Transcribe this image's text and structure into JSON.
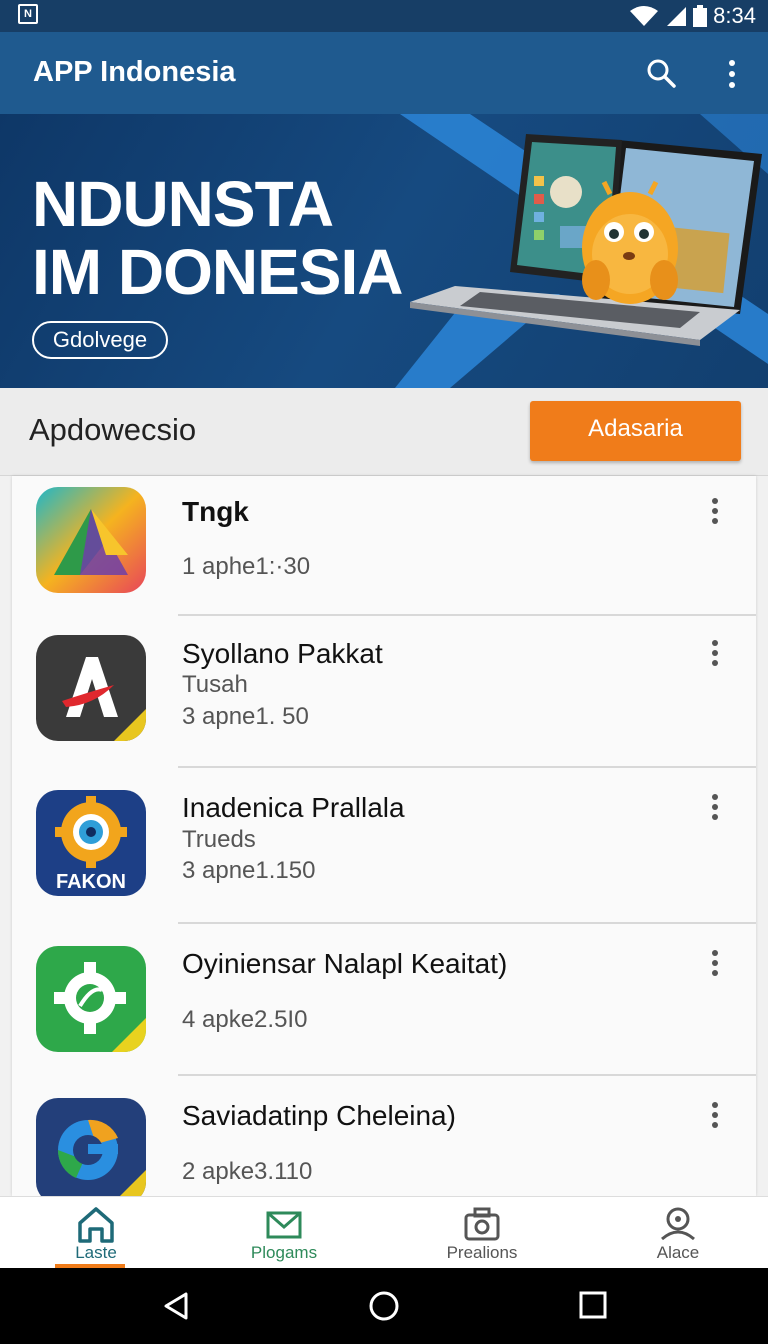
{
  "status_bar": {
    "left_badge": "N",
    "time": "8:34"
  },
  "app_bar": {
    "title": "APP Indonesia"
  },
  "banner": {
    "headline_line1": "NDUNSTA",
    "headline_line2": "IM DONESIA",
    "pill_label": "Gdolvege"
  },
  "toolbar": {
    "label": "Apdowecsio",
    "cta_label": "Adasaria"
  },
  "apps": [
    {
      "name": "Tngk",
      "sub": "",
      "meta": "1 aphe1:·30"
    },
    {
      "name": "Syollano Pakkat",
      "sub": "Tusah",
      "meta": "3 apne1. 50"
    },
    {
      "name": "Inadenica Prallala",
      "sub": "Trueds",
      "meta": "3 apne1.150",
      "icon_text": "FAKON"
    },
    {
      "name": "Oyiniensar Nalapl Keaitat)",
      "sub": "",
      "meta": "4 apke2.5I0"
    },
    {
      "name": "Saviadatinp Cheleina)",
      "sub": "",
      "meta": "2 apke3.110"
    }
  ],
  "bottom_nav": [
    {
      "label": "Laste",
      "icon": "home-icon",
      "active": true,
      "color": "#1e6a78"
    },
    {
      "label": "Plogams",
      "icon": "mail-icon",
      "active": false,
      "color": "#2e8a5a"
    },
    {
      "label": "Prealions",
      "icon": "camera-icon",
      "active": false,
      "color": "#555555"
    },
    {
      "label": "Alace",
      "icon": "profile-icon",
      "active": false,
      "color": "#555555"
    }
  ],
  "colors": {
    "app_bar": "#1f5a8f",
    "accent": "#f07c1a",
    "status_bar": "#173e66"
  }
}
